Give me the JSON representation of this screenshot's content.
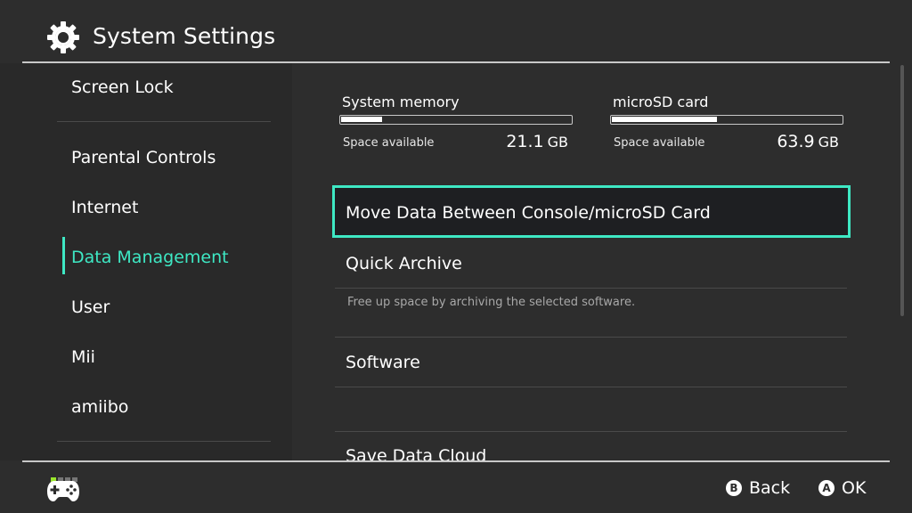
{
  "header": {
    "title": "System Settings",
    "icon": "gear-icon"
  },
  "sidebar": {
    "items": [
      {
        "label": "Screen Lock"
      },
      {
        "label": "Parental Controls"
      },
      {
        "label": "Internet"
      },
      {
        "label": "Data Management"
      },
      {
        "label": "User"
      },
      {
        "label": "Mii"
      },
      {
        "label": "amiibo"
      }
    ],
    "active": "Data Management",
    "accent_color": "#3ee8c4"
  },
  "storage": {
    "system": {
      "label": "System memory",
      "space_label": "Space available",
      "value": "21.1",
      "unit": "GB",
      "fill_fraction": 0.18
    },
    "microsd": {
      "label": "microSD card",
      "space_label": "Space available",
      "value": "63.9",
      "unit": "GB",
      "fill_fraction": 0.46
    }
  },
  "menu": {
    "items": [
      {
        "label": "Move Data Between Console/microSD Card"
      },
      {
        "label": "Quick Archive",
        "description": "Free up space by archiving the selected software."
      },
      {
        "label": "Software"
      },
      {
        "label": "Save Data Cloud"
      }
    ],
    "selected": "Move Data Between Console/microSD Card"
  },
  "footer": {
    "back": {
      "button": "B",
      "label": "Back"
    },
    "ok": {
      "button": "A",
      "label": "OK"
    },
    "controller_icon": "controller-icon"
  }
}
